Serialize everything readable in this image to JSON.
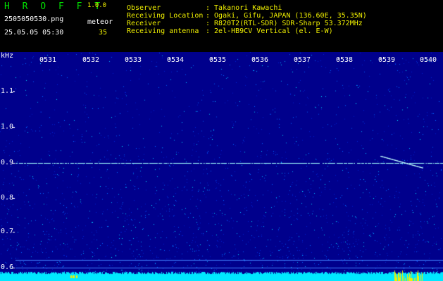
{
  "app": {
    "title": "H R O F F T",
    "version": "1.0.0"
  },
  "file": {
    "name": "2505050530.png",
    "timestamp": "25.05.05 05:30"
  },
  "meteor": {
    "label": "meteor",
    "count": "35"
  },
  "info": [
    {
      "key": "Observer",
      "value": ": Takanori Kawachi"
    },
    {
      "key": "Receiving Location",
      "value": ": Ogaki, Gifu, JAPAN (136.60E, 35.35N)"
    },
    {
      "key": "Receiver",
      "value": ": R820T2(RTL-SDR) SDR-Sharp 53.372MHz"
    },
    {
      "key": "Receiving antenna",
      "value": ": 2el-HB9CV Vertical (el. E-W)"
    }
  ],
  "spectrogram": {
    "y_unit": "kHz",
    "y_ticks": [
      "1.1",
      "1.0",
      "0.9",
      "0.8",
      "0.7",
      "0.6"
    ],
    "x_ticks": [
      "0531",
      "0532",
      "0533",
      "0534",
      "0535",
      "0536",
      "0537",
      "0538",
      "0539",
      "0540"
    ],
    "colors": {
      "background": "#00008c",
      "noise": "#00e0ff",
      "line": "#a0ffff",
      "bottom_band": "#00e8ff",
      "burst": "#f0f000"
    }
  }
}
